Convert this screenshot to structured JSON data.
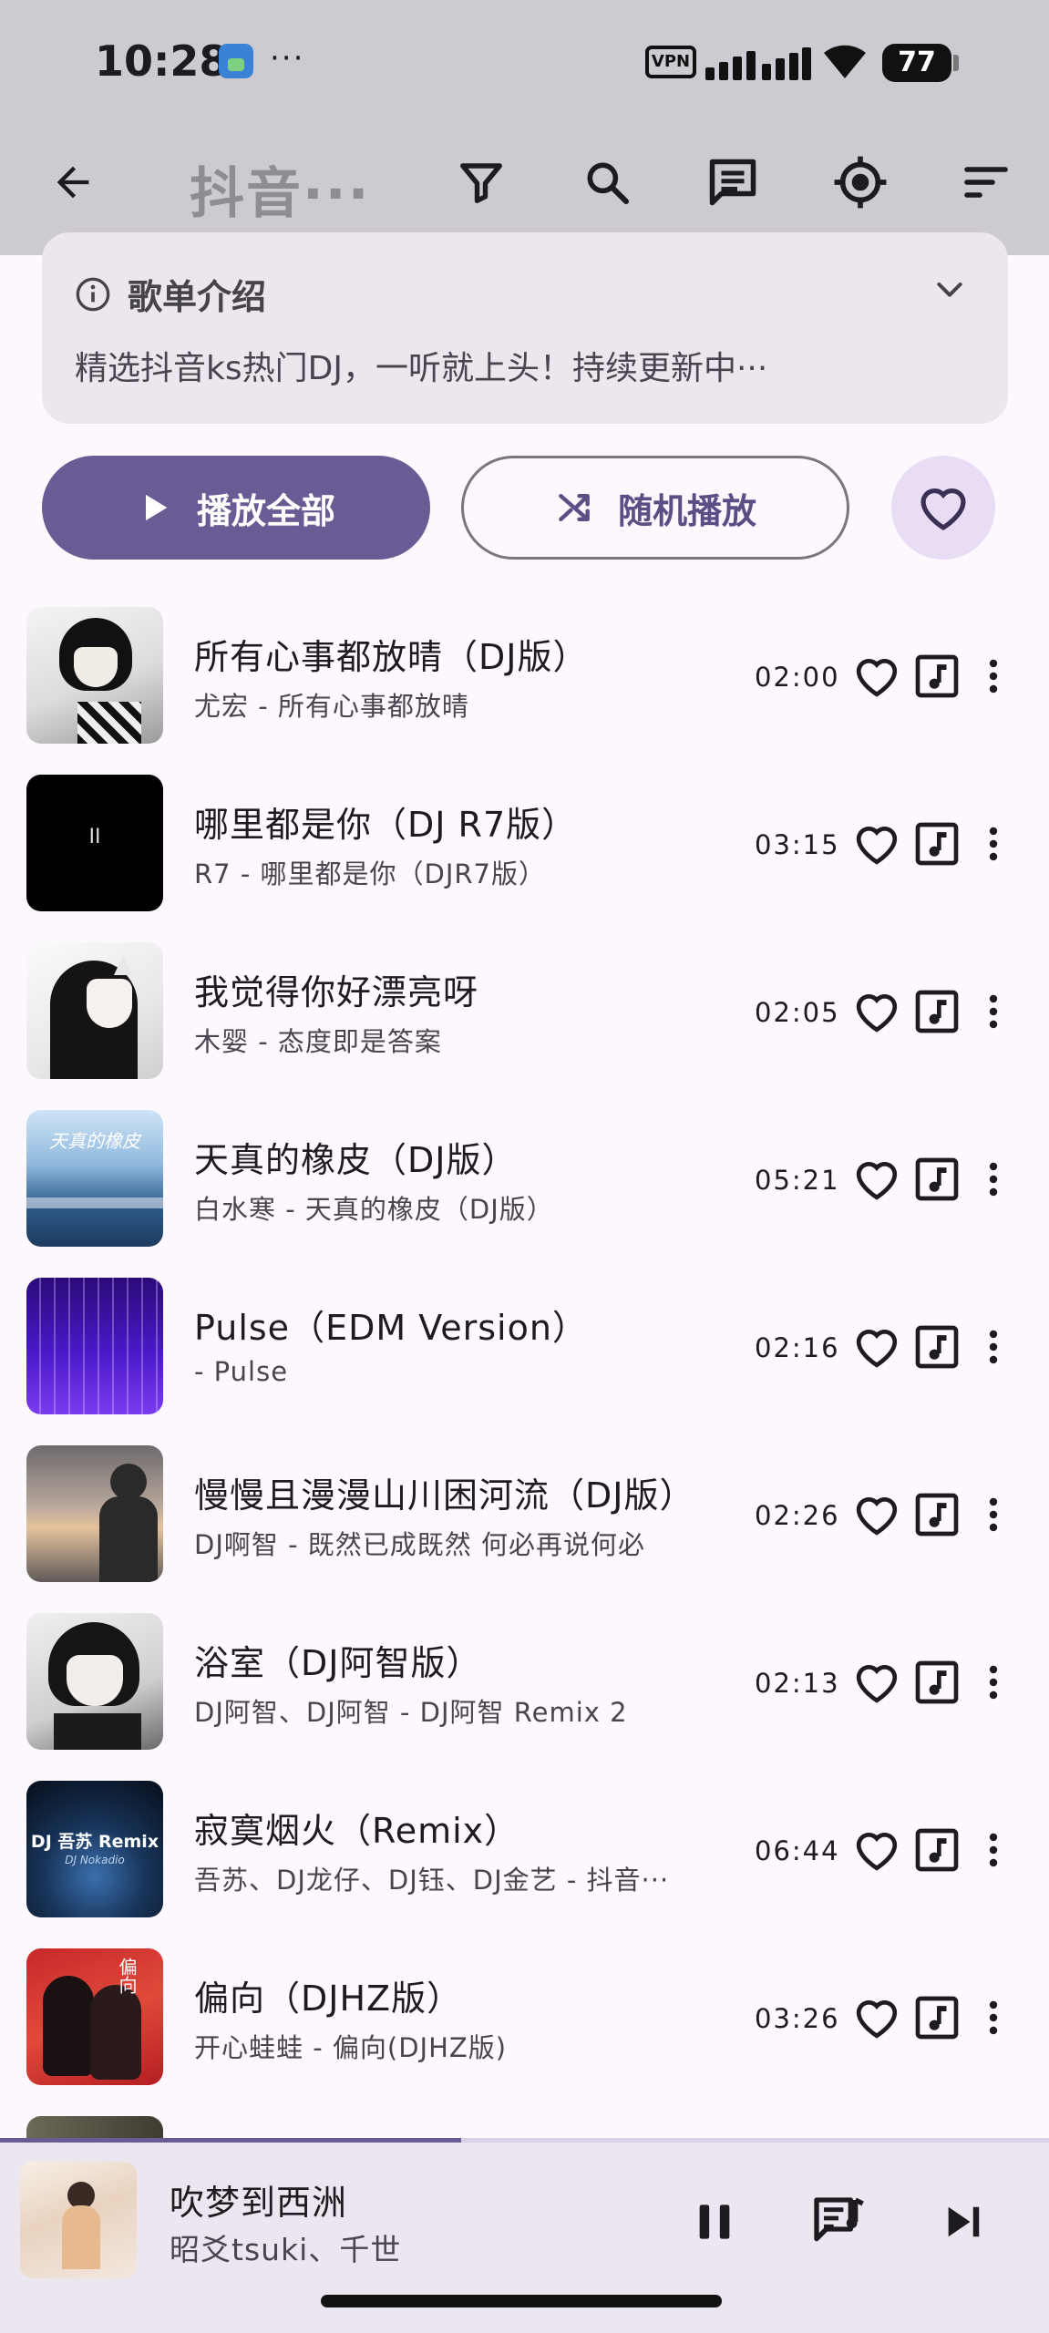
{
  "status_bar": {
    "time": "10:28",
    "more_dots": "···",
    "vpn_label": "VPN",
    "battery_level": "77"
  },
  "app_bar": {
    "title": "抖音···"
  },
  "intro": {
    "title": "歌单介绍",
    "description": "精选抖音ks热门DJ，一听就上头！持续更新中···"
  },
  "actions": {
    "play_all": "播放全部",
    "shuffle": "随机播放"
  },
  "songs": [
    {
      "title": "所有心事都放晴（DJ版）",
      "subtitle": "尤宏 - 所有心事都放晴",
      "duration": "02:00"
    },
    {
      "title": "哪里都是你（DJ R7版）",
      "subtitle": "R7 - 哪里都是你（DJR7版）",
      "duration": "03:15",
      "cover_text": "II"
    },
    {
      "title": "我觉得你好漂亮呀",
      "subtitle": "木婴 - 态度即是答案",
      "duration": "02:05"
    },
    {
      "title": "天真的橡皮（DJ版）",
      "subtitle": "白水寒 - 天真的橡皮（DJ版）",
      "duration": "05:21",
      "cover_text": "天真的橡皮"
    },
    {
      "title": "Pulse（EDM Version）",
      "subtitle": " - Pulse",
      "duration": "02:16"
    },
    {
      "title": "慢慢且漫漫山川困河流（DJ版）",
      "subtitle": "DJ啊智 - 既然已成既然 何必再说何必",
      "duration": "02:26"
    },
    {
      "title": "浴室（DJ阿智版）",
      "subtitle": "DJ阿智、DJ阿智 - DJ阿智 Remix 2",
      "duration": "02:13"
    },
    {
      "title": "寂寞烟火（Remix）",
      "subtitle": "吾苏、DJ龙仔、DJ钰、DJ金艺 - 抖音···",
      "duration": "06:44",
      "cover_text": "DJ 吾苏 Remix",
      "cover_subtext": "DJ Nokadio"
    },
    {
      "title": "偏向（DJHZ版）",
      "subtitle": "开心蛙蛙 - 偏向(DJHZ版)",
      "duration": "03:26",
      "cover_text": "偏向"
    }
  ],
  "player": {
    "title": "吹梦到西洲",
    "artist": "昭爻tsuki、千世",
    "progress_fraction": 0.44
  },
  "colors": {
    "accent": "#6b5b95",
    "status_bar_bg": "#cdcbd1",
    "background": "#fcf8fd",
    "player_bg": "#ece6f0"
  }
}
